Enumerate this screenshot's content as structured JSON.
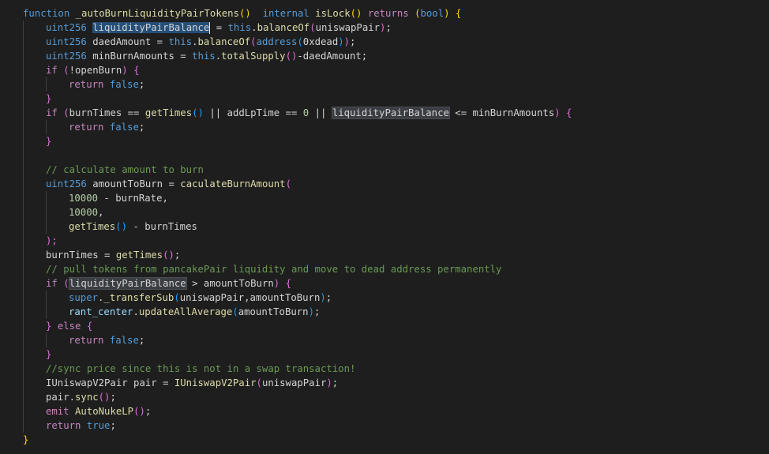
{
  "code": [
    {
      "indent": 0,
      "tokens": [
        {
          "t": "function",
          "c": "kw"
        },
        {
          "t": " "
        },
        {
          "t": "_autoBurnLiquidityPairTokens",
          "c": "fn"
        },
        {
          "t": "()",
          "c": "p1"
        },
        {
          "t": "  "
        },
        {
          "t": "internal",
          "c": "kw"
        },
        {
          "t": " "
        },
        {
          "t": "isLock",
          "c": "fn"
        },
        {
          "t": "()",
          "c": "p1"
        },
        {
          "t": " "
        },
        {
          "t": "returns",
          "c": "ctl"
        },
        {
          "t": " "
        },
        {
          "t": "(",
          "c": "p1"
        },
        {
          "t": "bool",
          "c": "kw"
        },
        {
          "t": ")",
          "c": "p1"
        },
        {
          "t": " "
        },
        {
          "t": "{",
          "c": "p1"
        }
      ]
    },
    {
      "indent": 1,
      "tokens": [
        {
          "t": "uint256",
          "c": "kw"
        },
        {
          "t": " "
        },
        {
          "t": "liquidityPairBalance",
          "c": "sel"
        },
        {
          "t": "",
          "c": "cursor"
        },
        {
          "t": " = "
        },
        {
          "t": "this",
          "c": "kw"
        },
        {
          "t": "."
        },
        {
          "t": "balanceOf",
          "c": "fn"
        },
        {
          "t": "(",
          "c": "p2"
        },
        {
          "t": "uniswapPair"
        },
        {
          "t": ")",
          "c": "p2"
        },
        {
          "t": ";"
        }
      ]
    },
    {
      "indent": 1,
      "tokens": [
        {
          "t": "uint256",
          "c": "kw"
        },
        {
          "t": " daedAmount = "
        },
        {
          "t": "this",
          "c": "kw"
        },
        {
          "t": "."
        },
        {
          "t": "balanceOf",
          "c": "fn"
        },
        {
          "t": "(",
          "c": "p2"
        },
        {
          "t": "address",
          "c": "kw"
        },
        {
          "t": "(",
          "c": "p3"
        },
        {
          "t": "0xdead"
        },
        {
          "t": ")",
          "c": "p3"
        },
        {
          "t": ")",
          "c": "p2"
        },
        {
          "t": ";"
        }
      ]
    },
    {
      "indent": 1,
      "tokens": [
        {
          "t": "uint256",
          "c": "kw"
        },
        {
          "t": " minBurnAmounts = "
        },
        {
          "t": "this",
          "c": "kw"
        },
        {
          "t": "."
        },
        {
          "t": "totalSupply",
          "c": "fn"
        },
        {
          "t": "()",
          "c": "p2"
        },
        {
          "t": "-daedAmount;"
        }
      ]
    },
    {
      "indent": 1,
      "tokens": [
        {
          "t": "if",
          "c": "ctl"
        },
        {
          "t": " "
        },
        {
          "t": "(",
          "c": "p2"
        },
        {
          "t": "!openBurn"
        },
        {
          "t": ")",
          "c": "p2"
        },
        {
          "t": " "
        },
        {
          "t": "{",
          "c": "p2"
        }
      ]
    },
    {
      "indent": 2,
      "tokens": [
        {
          "t": "return",
          "c": "ctl"
        },
        {
          "t": " "
        },
        {
          "t": "false",
          "c": "kw"
        },
        {
          "t": ";"
        }
      ]
    },
    {
      "indent": 1,
      "tokens": [
        {
          "t": "}",
          "c": "p2"
        }
      ]
    },
    {
      "indent": 1,
      "tokens": [
        {
          "t": "if",
          "c": "ctl"
        },
        {
          "t": " "
        },
        {
          "t": "(",
          "c": "p2"
        },
        {
          "t": "burnTimes == "
        },
        {
          "t": "getTimes",
          "c": "fn"
        },
        {
          "t": "()",
          "c": "p3"
        },
        {
          "t": " || addLpTime == "
        },
        {
          "t": "0",
          "c": "num"
        },
        {
          "t": " || "
        },
        {
          "t": "liquidityPairBalance",
          "c": "hl"
        },
        {
          "t": " <= minBurnAmounts"
        },
        {
          "t": ")",
          "c": "p2"
        },
        {
          "t": " "
        },
        {
          "t": "{",
          "c": "p2"
        }
      ]
    },
    {
      "indent": 2,
      "tokens": [
        {
          "t": "return",
          "c": "ctl"
        },
        {
          "t": " "
        },
        {
          "t": "false",
          "c": "kw"
        },
        {
          "t": ";"
        }
      ]
    },
    {
      "indent": 1,
      "tokens": [
        {
          "t": "}",
          "c": "p2"
        }
      ]
    },
    {
      "indent": 0,
      "tokens": []
    },
    {
      "indent": 1,
      "tokens": [
        {
          "t": "// calculate amount to burn",
          "c": "cm"
        }
      ]
    },
    {
      "indent": 1,
      "tokens": [
        {
          "t": "uint256",
          "c": "kw"
        },
        {
          "t": " amountToBurn = "
        },
        {
          "t": "caculateBurnAmount",
          "c": "fn"
        },
        {
          "t": "(",
          "c": "p2"
        }
      ]
    },
    {
      "indent": 2,
      "tokens": [
        {
          "t": "10000",
          "c": "num"
        },
        {
          "t": " - burnRate,"
        }
      ]
    },
    {
      "indent": 2,
      "tokens": [
        {
          "t": "10000",
          "c": "num"
        },
        {
          "t": ","
        }
      ]
    },
    {
      "indent": 2,
      "tokens": [
        {
          "t": "getTimes",
          "c": "fn"
        },
        {
          "t": "()",
          "c": "p3"
        },
        {
          "t": " - burnTimes"
        }
      ]
    },
    {
      "indent": 1,
      "tokens": [
        {
          "t": ");",
          "c": "p2"
        }
      ]
    },
    {
      "indent": 1,
      "tokens": [
        {
          "t": "burnTimes = "
        },
        {
          "t": "getTimes",
          "c": "fn"
        },
        {
          "t": "()",
          "c": "p2"
        },
        {
          "t": ";"
        }
      ]
    },
    {
      "indent": 1,
      "tokens": [
        {
          "t": "// pull tokens from pancakePair liquidity and move to dead address permanently",
          "c": "cm"
        }
      ]
    },
    {
      "indent": 1,
      "tokens": [
        {
          "t": "if",
          "c": "ctl"
        },
        {
          "t": " "
        },
        {
          "t": "(",
          "c": "p2"
        },
        {
          "t": "liquidityPairBalance",
          "c": "hl"
        },
        {
          "t": " > amountToBurn"
        },
        {
          "t": ")",
          "c": "p2"
        },
        {
          "t": " "
        },
        {
          "t": "{",
          "c": "p2"
        }
      ]
    },
    {
      "indent": 2,
      "tokens": [
        {
          "t": "super",
          "c": "kw"
        },
        {
          "t": "."
        },
        {
          "t": "_transferSub",
          "c": "fn"
        },
        {
          "t": "(",
          "c": "p3"
        },
        {
          "t": "uniswapPair,amountToBurn"
        },
        {
          "t": ")",
          "c": "p3"
        },
        {
          "t": ";"
        }
      ]
    },
    {
      "indent": 2,
      "tokens": [
        {
          "t": "rant_center",
          "c": "var"
        },
        {
          "t": "."
        },
        {
          "t": "updateAllAverage",
          "c": "fn"
        },
        {
          "t": "(",
          "c": "p3"
        },
        {
          "t": "amountToBurn"
        },
        {
          "t": ")",
          "c": "p3"
        },
        {
          "t": ";"
        }
      ]
    },
    {
      "indent": 1,
      "tokens": [
        {
          "t": "}",
          "c": "p2"
        },
        {
          "t": " "
        },
        {
          "t": "else",
          "c": "ctl"
        },
        {
          "t": " "
        },
        {
          "t": "{",
          "c": "p2"
        }
      ]
    },
    {
      "indent": 2,
      "tokens": [
        {
          "t": "return",
          "c": "ctl"
        },
        {
          "t": " "
        },
        {
          "t": "false",
          "c": "kw"
        },
        {
          "t": ";"
        }
      ]
    },
    {
      "indent": 1,
      "tokens": [
        {
          "t": "}",
          "c": "p2"
        }
      ]
    },
    {
      "indent": 1,
      "tokens": [
        {
          "t": "//sync price since this is not in a swap transaction!",
          "c": "cm"
        }
      ]
    },
    {
      "indent": 1,
      "tokens": [
        {
          "t": "IUniswapV2Pair pair = "
        },
        {
          "t": "IUniswapV2Pair",
          "c": "fn"
        },
        {
          "t": "(",
          "c": "p2"
        },
        {
          "t": "uniswapPair"
        },
        {
          "t": ")",
          "c": "p2"
        },
        {
          "t": ";"
        }
      ]
    },
    {
      "indent": 1,
      "tokens": [
        {
          "t": "pair"
        },
        {
          "t": "."
        },
        {
          "t": "sync",
          "c": "fn"
        },
        {
          "t": "()",
          "c": "p2"
        },
        {
          "t": ";"
        }
      ]
    },
    {
      "indent": 1,
      "tokens": [
        {
          "t": "emit",
          "c": "ctl"
        },
        {
          "t": " "
        },
        {
          "t": "AutoNukeLP",
          "c": "fn"
        },
        {
          "t": "()",
          "c": "p2"
        },
        {
          "t": ";"
        }
      ]
    },
    {
      "indent": 1,
      "tokens": [
        {
          "t": "return",
          "c": "ctl"
        },
        {
          "t": " "
        },
        {
          "t": "true",
          "c": "kw"
        },
        {
          "t": ";"
        }
      ]
    },
    {
      "indent": 0,
      "tokens": [
        {
          "t": "}",
          "c": "p1"
        }
      ]
    }
  ]
}
